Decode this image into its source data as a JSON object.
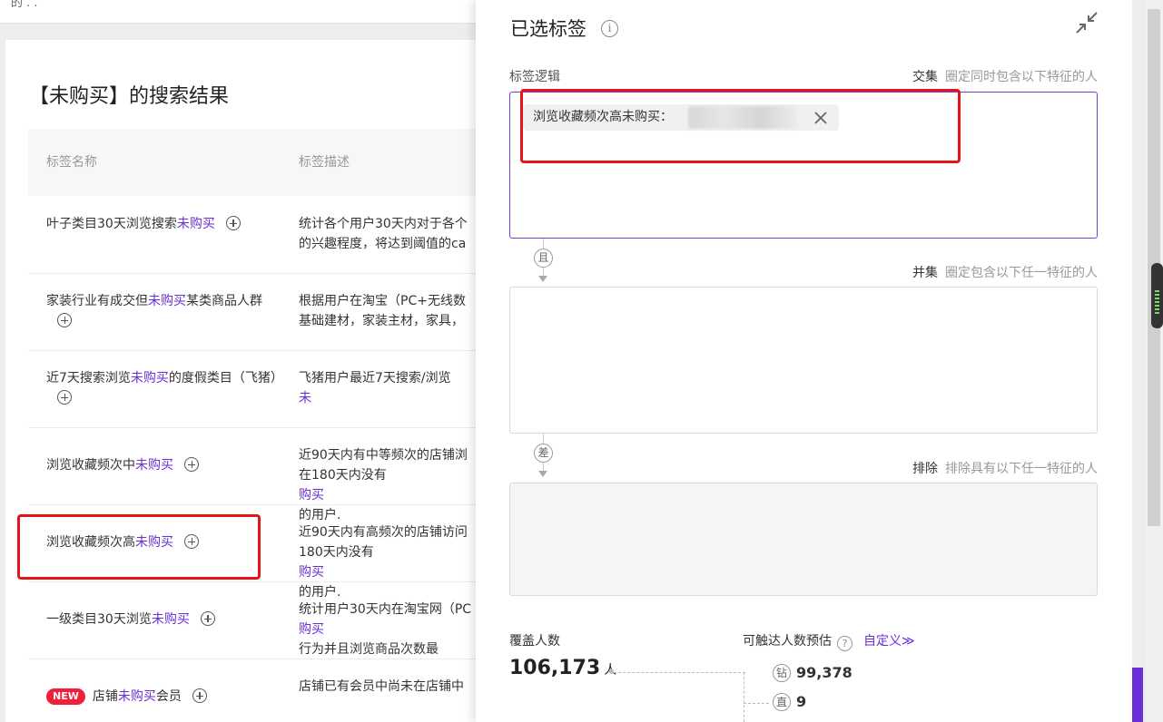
{
  "topbar": {
    "crumb": "的 . ."
  },
  "page": {
    "title": "【未购买】的搜索结果"
  },
  "table": {
    "headers": {
      "name": "标签名称",
      "desc": "标签描述"
    },
    "rows": [
      {
        "pre": "叶子类目30天浏览搜索",
        "hl": "未购买",
        "post": "",
        "desc1_pre": "统计各个用户30天内对于各个",
        "desc1_hl": "",
        "desc1_post": "",
        "desc2_pre": "的兴趣程度，将达到阈值的ca",
        "desc2_hl": "",
        "desc2_post": ""
      },
      {
        "pre": "家装行业有成交但",
        "hl": "未购买",
        "post": "某类商品人群",
        "desc1_pre": "根据用户在淘宝（PC+无线数",
        "desc1_hl": "",
        "desc1_post": "",
        "desc2_pre": "基础建材，家装主材，家具，",
        "desc2_hl": "",
        "desc2_post": ""
      },
      {
        "pre": "近7天搜索浏览",
        "hl": "未购买",
        "post": "的度假类目（飞猪）",
        "desc1_pre": "飞猪用户最近7天搜索/浏览",
        "desc1_hl": "未",
        "desc1_post": "",
        "desc2_pre": "",
        "desc2_hl": "",
        "desc2_post": ""
      },
      {
        "pre": "浏览收藏频次中",
        "hl": "未购买",
        "post": "",
        "desc1_pre": "近90天内有中等频次的店铺浏",
        "desc1_hl": "",
        "desc1_post": "",
        "desc2_pre": "在180天内没有",
        "desc2_hl": "购买",
        "desc2_post": "的用户."
      },
      {
        "pre": "浏览收藏频次高",
        "hl": "未购买",
        "post": "",
        "desc1_pre": "近90天内有高频次的店铺访问",
        "desc1_hl": "",
        "desc1_post": "",
        "desc2_pre": "180天内没有",
        "desc2_hl": "购买",
        "desc2_post": "的用户."
      },
      {
        "pre": "一级类目30天浏览",
        "hl": "未购买",
        "post": "",
        "desc1_pre": "统计用户30天内在淘宝网（PC",
        "desc1_hl": "",
        "desc1_post": "",
        "desc2_pre": "",
        "desc2_hl": "购买",
        "desc2_post": "行为并且浏览商品次数最"
      },
      {
        "badge": "NEW",
        "pre": "店铺",
        "hl": "未购买",
        "post": "会员",
        "desc1_pre": "店铺已有会员中尚未在店铺中",
        "desc1_hl": "",
        "desc1_post": "",
        "desc2_pre": "",
        "desc2_hl": "",
        "desc2_post": ""
      }
    ]
  },
  "drawer": {
    "title": "已选标签",
    "info_icon": "i",
    "label_logic": "标签逻辑",
    "intersection": {
      "label": "交集",
      "sub": "圈定同时包含以下特征的人"
    },
    "union": {
      "label": "并集",
      "sub": "圈定包含以下任一特征的人"
    },
    "exclude": {
      "label": "排除",
      "sub": "排除具有以下任一特征的人"
    },
    "selected_tag": "浏览收藏频次高未购买：",
    "connector_and": "且",
    "connector_diff": "差",
    "coverage_label": "覆盖人数",
    "coverage_value": "106,173",
    "coverage_unit": "人",
    "reach_label": "可触达人数预估",
    "reach_help": "?",
    "custom_link": "自定义≫",
    "reach_items": [
      {
        "char": "钻",
        "value": "99,378"
      },
      {
        "char": "直",
        "value": "9"
      }
    ]
  },
  "colors": {
    "accent": "#6b2fd6",
    "highlight_box": "#e3161a"
  },
  "icons": [
    "info-icon",
    "collapse-icon",
    "close-icon",
    "plus-circle-icon",
    "help-icon"
  ]
}
